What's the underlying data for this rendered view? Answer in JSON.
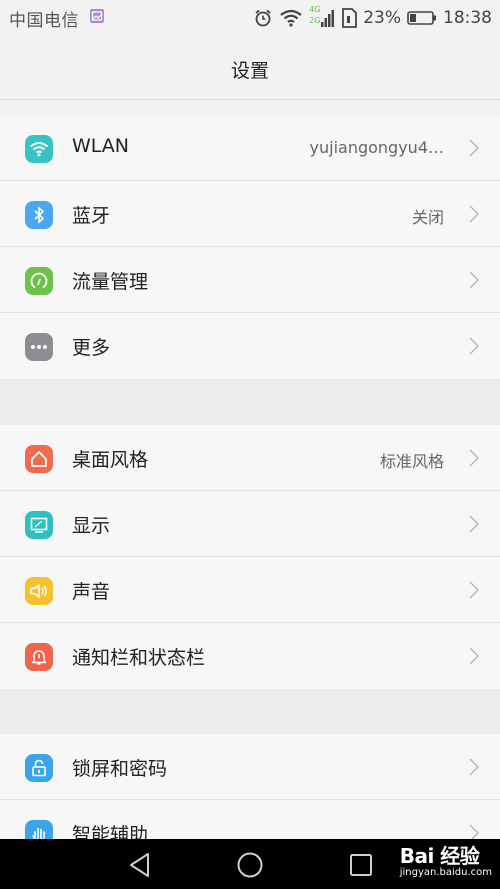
{
  "status_bar": {
    "carrier": "中国电信",
    "network_4g": "4G",
    "network_2g": "2G",
    "battery": "23%",
    "time": "18:38"
  },
  "title": "设置",
  "groups": [
    {
      "items": [
        {
          "label": "WLAN",
          "value": "yujiangongyu4…",
          "icon": "wifi-icon",
          "color": "#35c3c3"
        },
        {
          "label": "蓝牙",
          "value": "关闭",
          "icon": "bluetooth-icon",
          "color": "#4aa8ee"
        },
        {
          "label": "流量管理",
          "value": "",
          "icon": "data-usage-icon",
          "color": "#6ec24a"
        },
        {
          "label": "更多",
          "value": "",
          "icon": "more-icon",
          "color": "#8d8d93"
        }
      ]
    },
    {
      "items": [
        {
          "label": "桌面风格",
          "value": "标准风格",
          "icon": "home-icon",
          "color": "#f16a4d"
        },
        {
          "label": "显示",
          "value": "",
          "icon": "display-icon",
          "color": "#2ebfc0"
        },
        {
          "label": "声音",
          "value": "",
          "icon": "sound-icon",
          "color": "#f7c02d"
        },
        {
          "label": "通知栏和状态栏",
          "value": "",
          "icon": "notification-icon",
          "color": "#f1634a"
        }
      ]
    },
    {
      "items": [
        {
          "label": "锁屏和密码",
          "value": "",
          "icon": "lock-icon",
          "color": "#3ba5ea"
        },
        {
          "label": "智能辅助",
          "value": "",
          "icon": "hand-icon",
          "color": "#3ba5ea"
        }
      ]
    }
  ],
  "watermark": {
    "top": "Bai 经验",
    "bottom": "jingyan.baidu.com"
  }
}
